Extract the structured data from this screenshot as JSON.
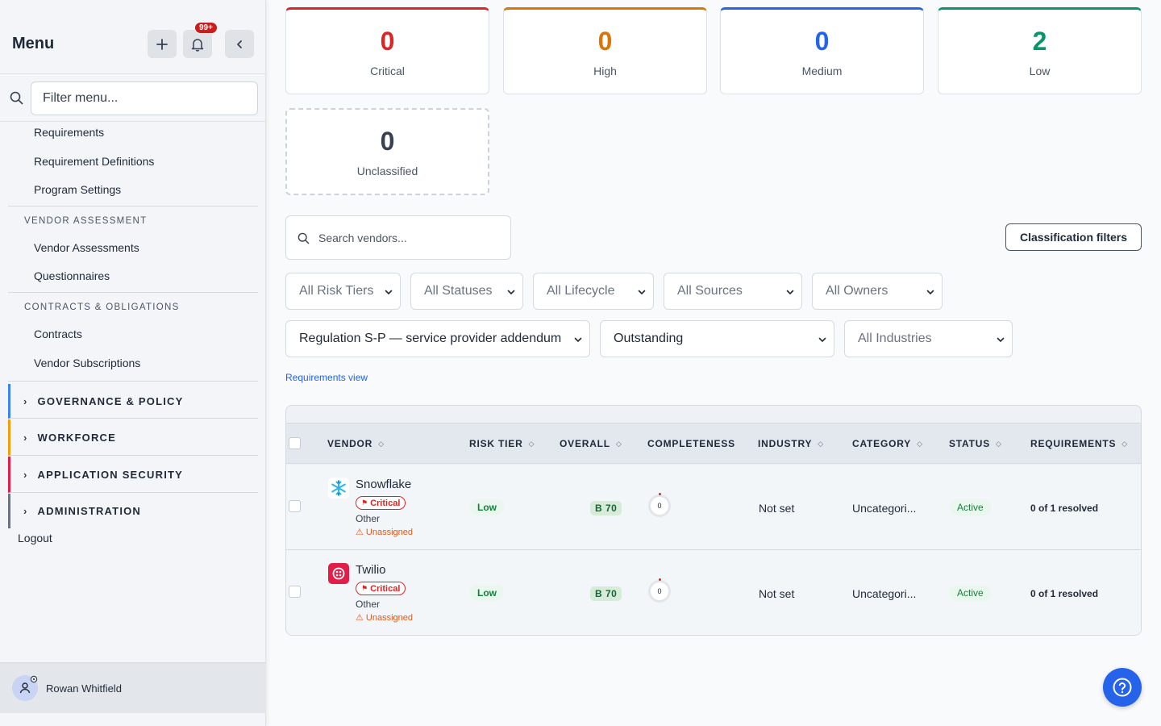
{
  "sidebar": {
    "title": "Menu",
    "notification_count": "99+",
    "filter_placeholder": "Filter menu...",
    "items_top": [
      "Requirements",
      "Requirement Definitions",
      "Program Settings"
    ],
    "vendor_assessment": {
      "heading": "VENDOR ASSESSMENT",
      "items": [
        "Vendor Assessments",
        "Questionnaires"
      ]
    },
    "contracts": {
      "heading": "CONTRACTS & OBLIGATIONS",
      "items": [
        "Contracts",
        "Vendor Subscriptions"
      ]
    },
    "groups": [
      {
        "label": "GOVERNANCE & POLICY",
        "color": "#3b82f6"
      },
      {
        "label": "WORKFORCE",
        "color": "#f59e0b"
      },
      {
        "label": "APPLICATION SECURITY",
        "color": "#e11d48"
      },
      {
        "label": "ADMINISTRATION",
        "color": "#6b7280"
      }
    ],
    "logout": "Logout",
    "user_name": "Rowan Whitfield"
  },
  "stats": [
    {
      "value": "0",
      "label": "Critical",
      "color": "#dc2626"
    },
    {
      "value": "0",
      "label": "High",
      "color": "#d97706"
    },
    {
      "value": "0",
      "label": "Medium",
      "color": "#2563eb"
    },
    {
      "value": "2",
      "label": "Low",
      "color": "#059669"
    },
    {
      "value": "0",
      "label": "Unclassified",
      "color": "#374151"
    }
  ],
  "toolbar": {
    "search_placeholder": "Search vendors...",
    "classification_button": "Classification filters",
    "filters": [
      "All Risk Tiers",
      "All Statuses",
      "All Lifecycle",
      "All Sources",
      "All Owners"
    ],
    "requirement_filter": "Regulation S-P — service provider addendum",
    "status_filter": "Outstanding",
    "industry_filter": "All Industries",
    "requirements_link": "Requirements view"
  },
  "table": {
    "columns": [
      "VENDOR",
      "RISK TIER",
      "OVERALL",
      "COMPLETENESS",
      "INDUSTRY",
      "CATEGORY",
      "STATUS",
      "REQUIREMENTS"
    ],
    "rows": [
      {
        "vendor": "Snowflake",
        "criticality": "Critical",
        "category_tag": "Other",
        "owner": "⚠ Unassigned",
        "risk_tier": "Low",
        "overall": "B 70",
        "completeness": "0",
        "industry": "Not set",
        "category": "Uncategori...",
        "status": "Active",
        "requirements": "0 of 1 resolved"
      },
      {
        "vendor": "Twilio",
        "criticality": "Critical",
        "category_tag": "Other",
        "owner": "⚠ Unassigned",
        "risk_tier": "Low",
        "overall": "B 70",
        "completeness": "0",
        "industry": "Not set",
        "category": "Uncategori...",
        "status": "Active",
        "requirements": "0 of 1 resolved"
      }
    ]
  }
}
